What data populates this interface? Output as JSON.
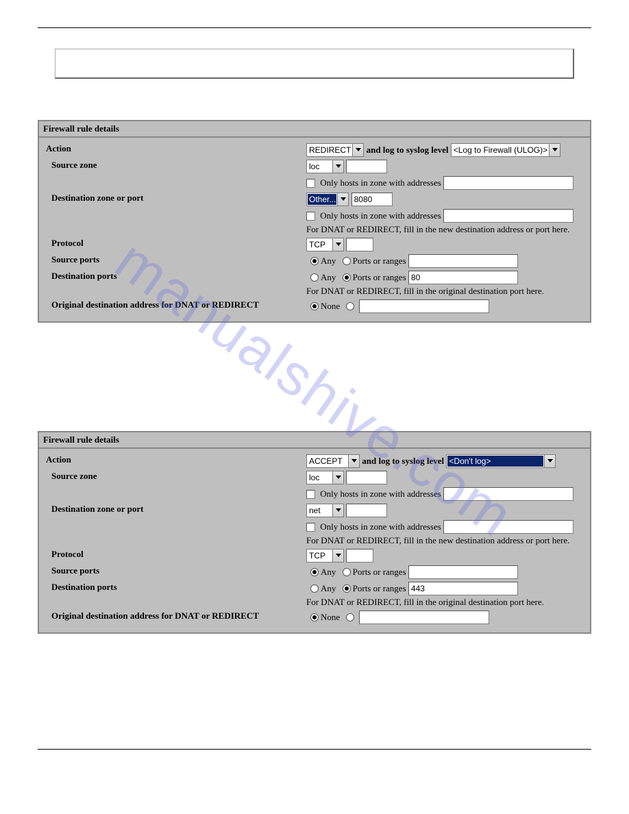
{
  "watermark": "manualshive.com",
  "panels": [
    {
      "title": "Firewall rule details",
      "action": {
        "label": "Action",
        "select": "REDIRECT",
        "log_label": "and log to syslog level",
        "log_select": "<Log to Firewall (ULOG)>",
        "log_highlight": false
      },
      "source_zone": {
        "label": "Source zone",
        "select": "loc",
        "text": "",
        "only_hosts_label": "Only hosts in zone with addresses",
        "only_hosts_text": ""
      },
      "dest_zone": {
        "label": "Destination zone or port",
        "select": "Other...",
        "select_highlight": true,
        "text": "8080",
        "only_hosts_label": "Only hosts in zone with addresses",
        "only_hosts_text": "",
        "hint": "For DNAT or REDIRECT, fill in the new destination address or port here."
      },
      "protocol": {
        "label": "Protocol",
        "select": "TCP",
        "text": ""
      },
      "source_ports": {
        "label": "Source ports",
        "any_label": "Any",
        "ports_label": "Ports or ranges",
        "selected": "any",
        "text": ""
      },
      "dest_ports": {
        "label": "Destination ports",
        "any_label": "Any",
        "ports_label": "Ports or ranges",
        "selected": "ports",
        "text": "80",
        "hint": "For DNAT or REDIRECT, fill in the original destination port here."
      },
      "orig_dest": {
        "label": "Original destination address for DNAT or REDIRECT",
        "none_label": "None",
        "selected": "none",
        "text": ""
      }
    },
    {
      "title": "Firewall rule details",
      "action": {
        "label": "Action",
        "select": "ACCEPT",
        "log_label": "and log to syslog level",
        "log_select": "<Don't log>",
        "log_highlight": true
      },
      "source_zone": {
        "label": "Source zone",
        "select": "loc",
        "text": "",
        "only_hosts_label": "Only hosts in zone with addresses",
        "only_hosts_text": ""
      },
      "dest_zone": {
        "label": "Destination zone or port",
        "select": "net",
        "select_highlight": false,
        "text": "",
        "only_hosts_label": "Only hosts in zone with addresses",
        "only_hosts_text": "",
        "hint": "For DNAT or REDIRECT, fill in the new destination address or port here."
      },
      "protocol": {
        "label": "Protocol",
        "select": "TCP",
        "text": ""
      },
      "source_ports": {
        "label": "Source ports",
        "any_label": "Any",
        "ports_label": "Ports or ranges",
        "selected": "any",
        "text": ""
      },
      "dest_ports": {
        "label": "Destination ports",
        "any_label": "Any",
        "ports_label": "Ports or ranges",
        "selected": "ports",
        "text": "443",
        "hint": "For DNAT or REDIRECT, fill in the original destination port here."
      },
      "orig_dest": {
        "label": "Original destination address for DNAT or REDIRECT",
        "none_label": "None",
        "selected": "none",
        "text": ""
      }
    }
  ]
}
